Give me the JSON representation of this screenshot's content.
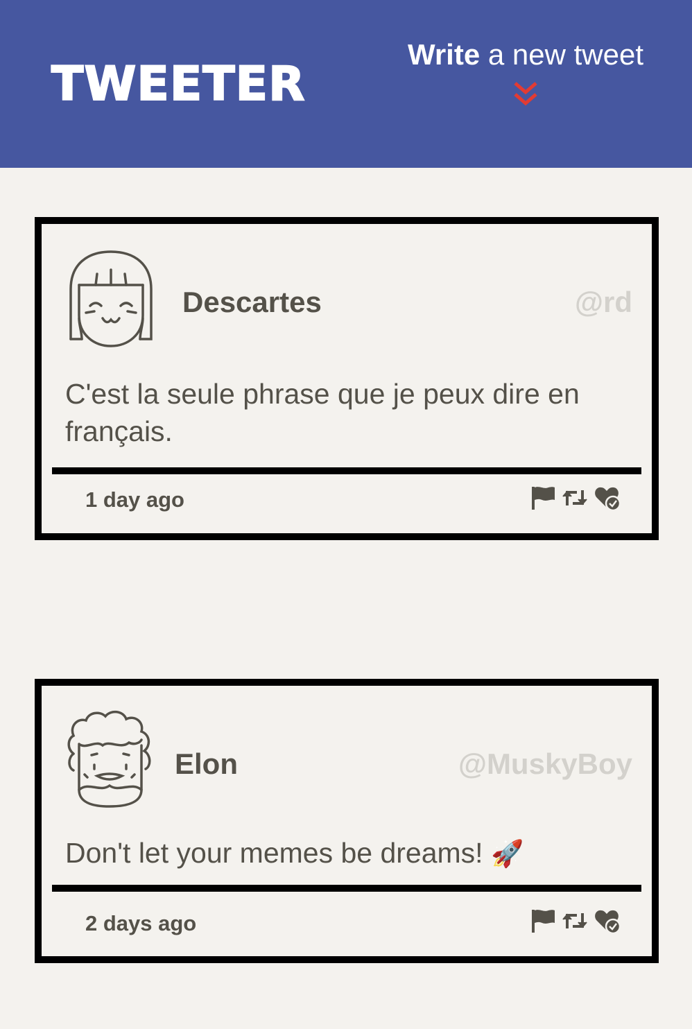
{
  "app": {
    "brand": "TWEETER"
  },
  "compose": {
    "bold": "Write",
    "rest": " a new tweet",
    "arrow_icon": "double-chevron-down-icon",
    "arrow_color": "#e23b33"
  },
  "colors": {
    "nav": "#4657a0",
    "page": "#f4f2ee",
    "text": "#545149",
    "handle": "#d3d1cc"
  },
  "tweets": [
    {
      "name": "Descartes",
      "handle": "@rd",
      "text": "C'est la seule phrase que je peux dire en français.",
      "time": "1 day ago",
      "avatar_icon": "girl-face-avatar"
    },
    {
      "name": "Elon",
      "handle": "@MuskyBoy",
      "text": "Don't let your memes be dreams! ",
      "emoji": "🚀",
      "time": "2 days ago",
      "avatar_icon": "curly-hair-face-avatar"
    }
  ],
  "action_icons": [
    "flag-icon",
    "retweet-icon",
    "heart-check-icon"
  ]
}
